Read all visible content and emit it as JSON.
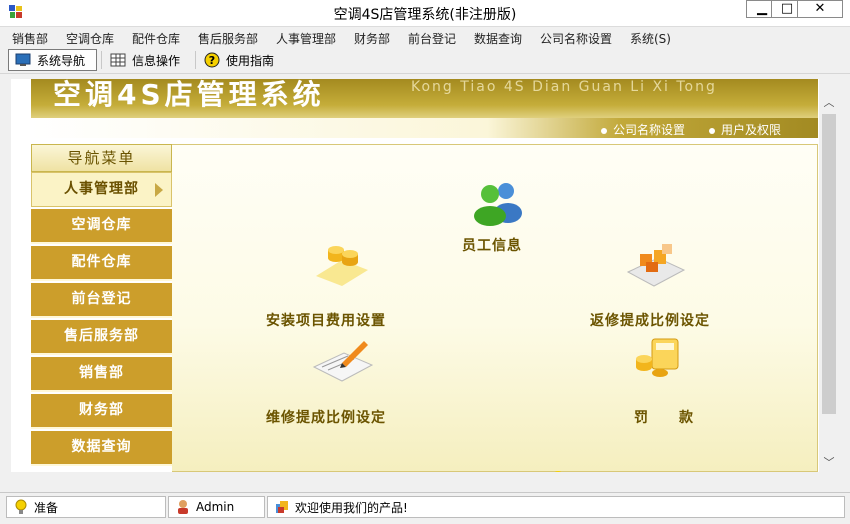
{
  "window": {
    "title": "空调4S店管理系统(非注册版)",
    "minimize": "▁",
    "maximize": "□",
    "close": "✕"
  },
  "menu": [
    "销售部",
    "空调仓库",
    "配件仓库",
    "售后服务部",
    "人事管理部",
    "财务部",
    "前台登记",
    "数据查询",
    "公司名称设置",
    "系统(S)"
  ],
  "toolbar": {
    "nav": "系统导航",
    "info": "信息操作",
    "guide": "使用指南"
  },
  "header": {
    "title": "空调4S店管理系统",
    "ghost": "Kong Tiao 4S Dian Guan Li Xi Tong",
    "link_company": "公司名称设置",
    "link_users": "用户及权限"
  },
  "nav": {
    "title": "导航菜单",
    "items": [
      "人事管理部",
      "空调仓库",
      "配件仓库",
      "前台登记",
      "售后服务部",
      "销售部",
      "财务部",
      "数据查询"
    ],
    "selected_index": 0
  },
  "features": {
    "staff": "员工信息",
    "install": "安装项目费用设置",
    "return": "返修提成比例设定",
    "repair": "维修提成比例设定",
    "fine": "罚　　款"
  },
  "status": {
    "ready": "准备",
    "user": "Admin",
    "welcome": "欢迎使用我们的产品!"
  },
  "colors": {
    "accent_gold": "#cc9e2b",
    "header_dark": "#a48a1f",
    "label_brown": "#6b5400"
  }
}
